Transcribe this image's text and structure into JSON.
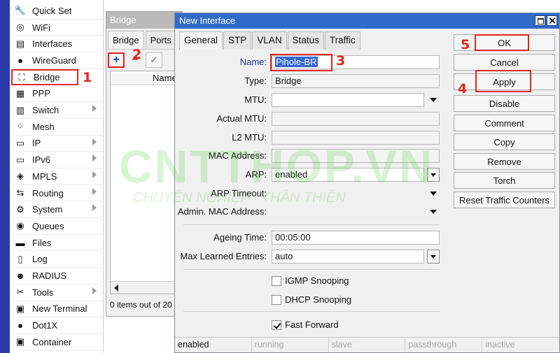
{
  "menu": {
    "items": [
      {
        "label": "Quick Set",
        "icon": "quick-set-icon",
        "glyph": "🔧",
        "submenu": false
      },
      {
        "label": "WiFi",
        "icon": "wifi-icon",
        "glyph": "◎",
        "submenu": false
      },
      {
        "label": "Interfaces",
        "icon": "interfaces-icon",
        "glyph": "▤",
        "submenu": false
      },
      {
        "label": "WireGuard",
        "icon": "wireguard-icon",
        "glyph": "●",
        "submenu": false
      },
      {
        "label": "Bridge",
        "icon": "bridge-icon",
        "glyph": "⛶",
        "submenu": false
      },
      {
        "label": "PPP",
        "icon": "ppp-icon",
        "glyph": "▦",
        "submenu": false
      },
      {
        "label": "Switch",
        "icon": "switch-icon",
        "glyph": "▥",
        "submenu": true
      },
      {
        "label": "Mesh",
        "icon": "mesh-icon",
        "glyph": "⁘",
        "submenu": false
      },
      {
        "label": "IP",
        "icon": "ip-icon",
        "glyph": "▭",
        "submenu": true
      },
      {
        "label": "IPv6",
        "icon": "ipv6-icon",
        "glyph": "▭",
        "submenu": true
      },
      {
        "label": "MPLS",
        "icon": "mpls-icon",
        "glyph": "◈",
        "submenu": true
      },
      {
        "label": "Routing",
        "icon": "routing-icon",
        "glyph": "⇆",
        "submenu": true
      },
      {
        "label": "System",
        "icon": "system-icon",
        "glyph": "⚙",
        "submenu": true
      },
      {
        "label": "Queues",
        "icon": "queues-icon",
        "glyph": "◉",
        "submenu": false
      },
      {
        "label": "Files",
        "icon": "files-icon",
        "glyph": "▬",
        "submenu": false
      },
      {
        "label": "Log",
        "icon": "log-icon",
        "glyph": "▯",
        "submenu": false
      },
      {
        "label": "RADIUS",
        "icon": "radius-icon",
        "glyph": "☻",
        "submenu": false
      },
      {
        "label": "Tools",
        "icon": "tools-icon",
        "glyph": "✂",
        "submenu": true
      },
      {
        "label": "New Terminal",
        "icon": "terminal-icon",
        "glyph": "▣",
        "submenu": false
      },
      {
        "label": "Dot1X",
        "icon": "dot1x-icon",
        "glyph": "●",
        "submenu": false
      },
      {
        "label": "Container",
        "icon": "container-icon",
        "glyph": "▣",
        "submenu": false
      }
    ]
  },
  "bridge_window": {
    "title": "Bridge",
    "tabs": [
      "Bridge",
      "Ports"
    ],
    "add_glyph": "+",
    "minus_glyph": "−",
    "check_glyph": "✓",
    "column_name": "Name",
    "status": "0 items out of 20"
  },
  "dialog": {
    "title": "New Interface",
    "tabs": [
      "General",
      "STP",
      "VLAN",
      "Status",
      "Traffic"
    ],
    "fields": {
      "name": {
        "label": "Name:",
        "value": "Pihole-BR"
      },
      "type": {
        "label": "Type:",
        "value": "Bridge"
      },
      "mtu": {
        "label": "MTU:",
        "value": ""
      },
      "actual_mtu": {
        "label": "Actual MTU:",
        "value": ""
      },
      "l2_mtu": {
        "label": "L2 MTU:",
        "value": ""
      },
      "mac_address": {
        "label": "MAC Address:",
        "value": ""
      },
      "arp": {
        "label": "ARP:",
        "value": "enabled"
      },
      "arp_timeout": {
        "label": "ARP Timeout:",
        "value": ""
      },
      "admin_mac": {
        "label": "Admin. MAC Address:",
        "value": ""
      },
      "ageing_time": {
        "label": "Ageing Time:",
        "value": "00:05:00"
      },
      "max_learned": {
        "label": "Max Learned Entries:",
        "value": "auto"
      }
    },
    "checkboxes": {
      "igmp": {
        "label": "IGMP Snooping",
        "checked": false
      },
      "dhcp": {
        "label": "DHCP Snooping",
        "checked": false
      },
      "fast_forward": {
        "label": "Fast Forward",
        "checked": true
      }
    },
    "buttons": {
      "ok": "OK",
      "cancel": "Cancel",
      "apply": "Apply",
      "disable": "Disable",
      "comment": "Comment",
      "copy": "Copy",
      "remove": "Remove",
      "torch": "Torch",
      "reset": "Reset Traffic Counters"
    },
    "status": [
      "enabled",
      "running",
      "slave",
      "passthrough",
      "inactive"
    ]
  },
  "annotations": [
    "1",
    "2",
    "3",
    "4",
    "5"
  ],
  "watermark": {
    "big": "CNTTHOP.VN",
    "small": "CHUYÊN NGHIỆP - THÂN THIỆN"
  },
  "colors": {
    "highlight": "#e0261e",
    "titlebar": "#2f6cc9",
    "menu_strip": "#2a3aa8",
    "selection": "#3467d4"
  }
}
